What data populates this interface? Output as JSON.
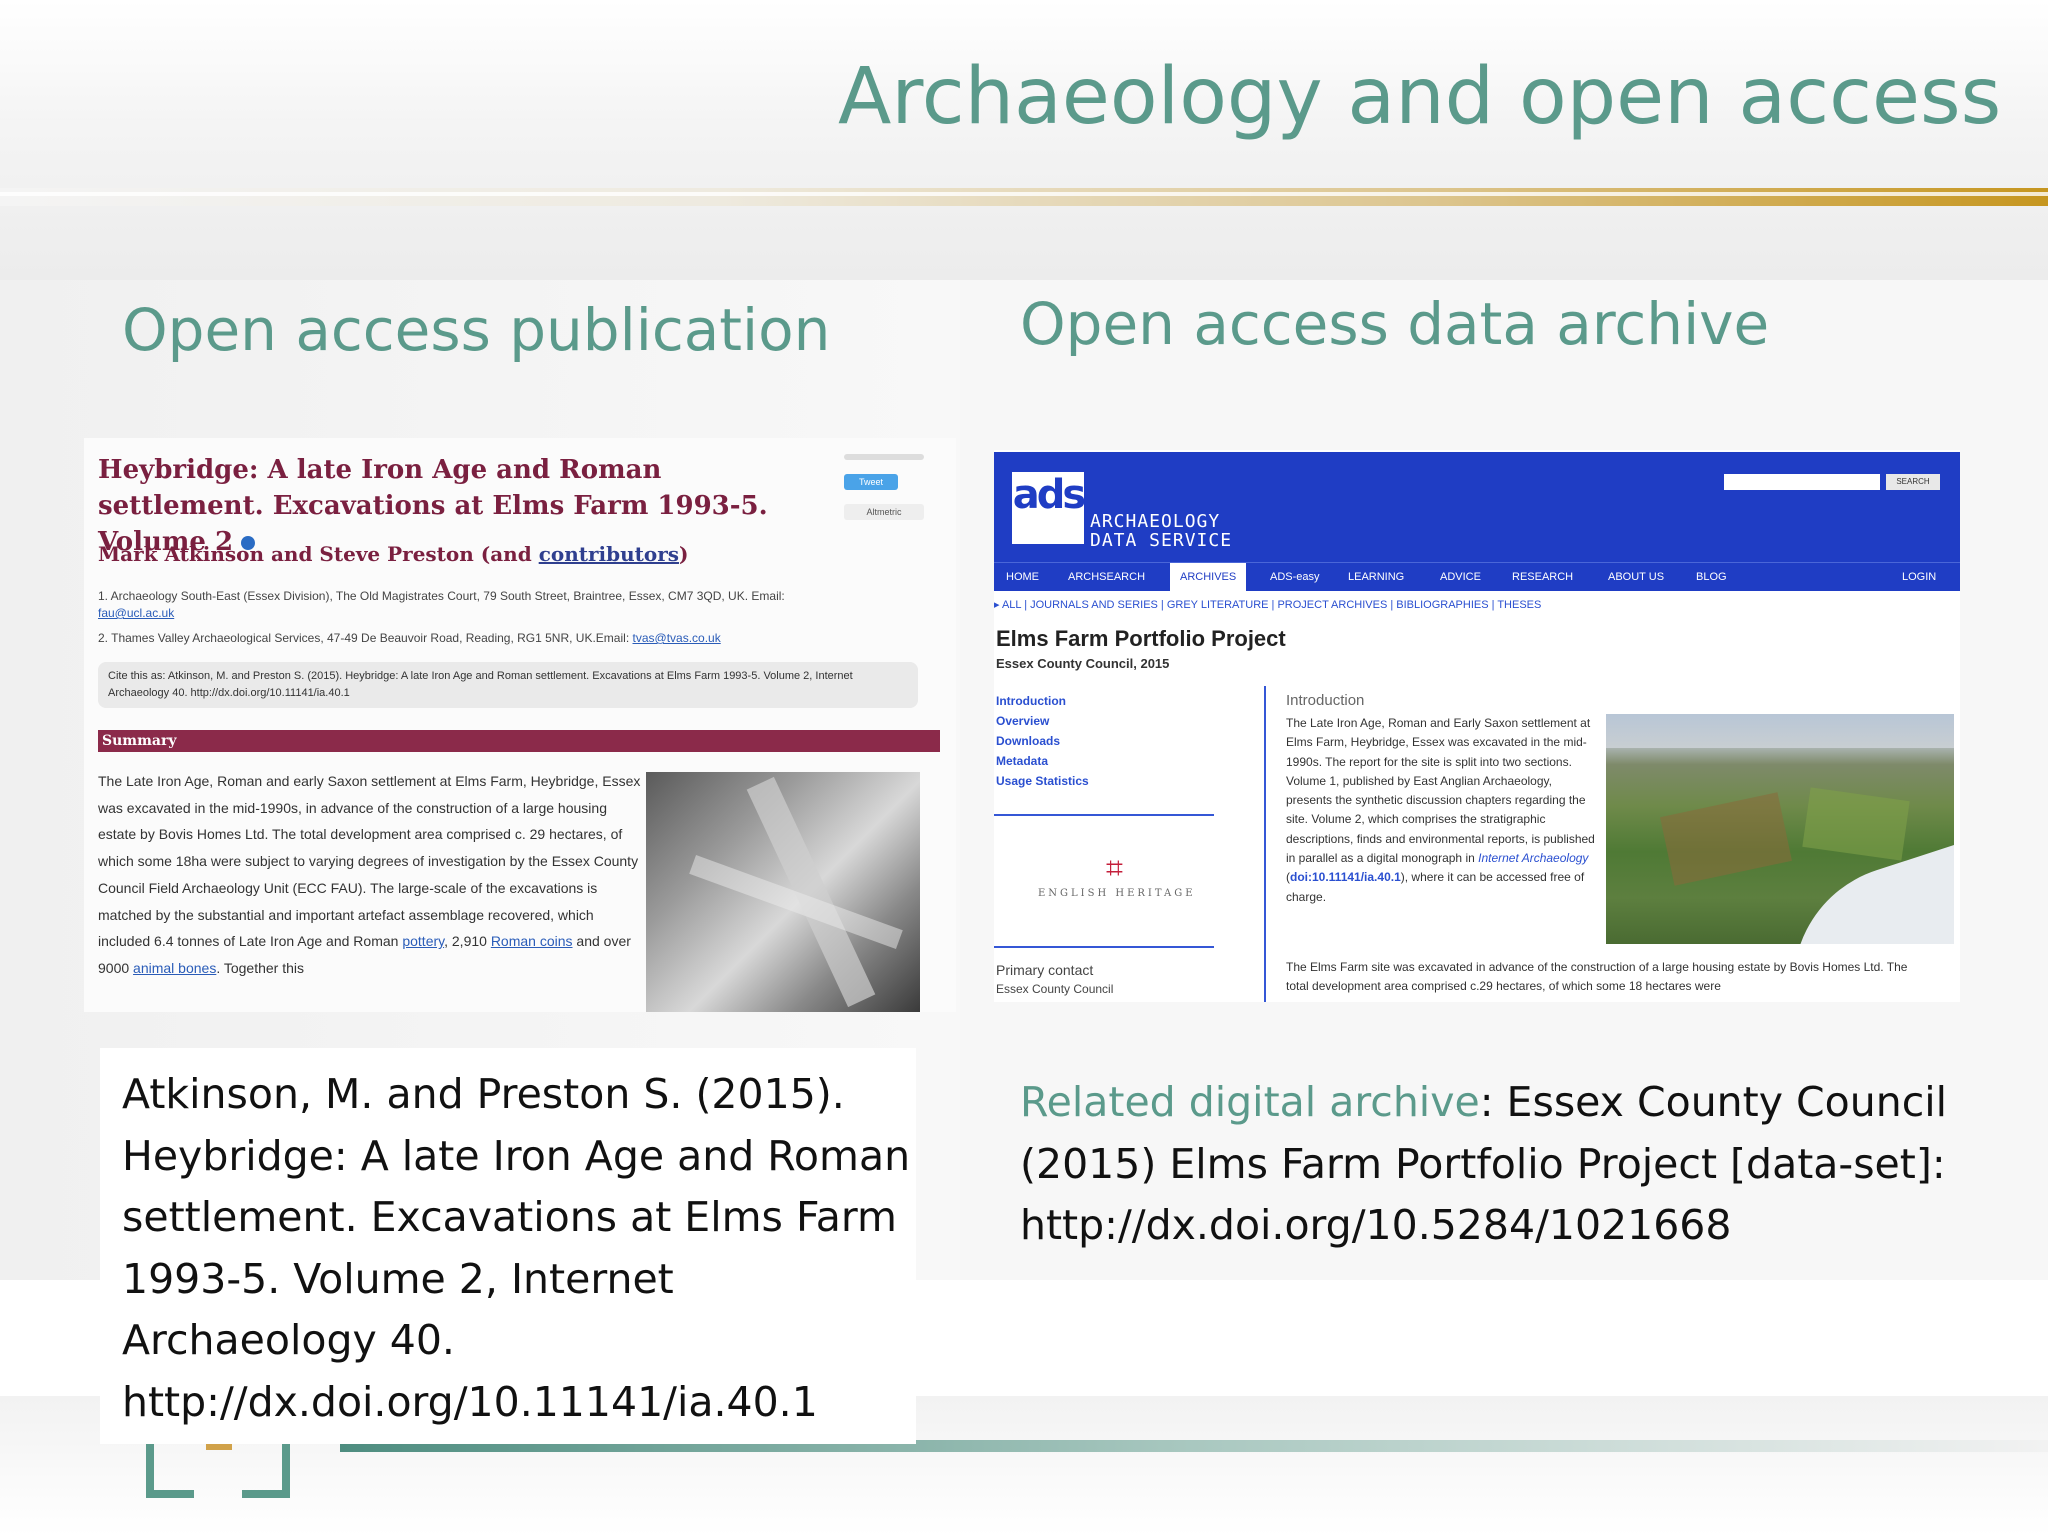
{
  "slide": {
    "title": "Archaeology and open access",
    "left_heading": "Open access publication",
    "right_heading": "Open access data archive",
    "accent_color": "#5b9a8b",
    "gold_color": "#c6961f"
  },
  "publication_screenshot": {
    "title": "Heybridge: A late Iron Age and Roman settlement. Excavations at Elms Farm 1993-5. Volume 2",
    "authors": "Mark Atkinson and Steve Preston (and ",
    "authors_link": "contributors",
    "authors_close": ")",
    "share_buttons": [
      "Tweet",
      "Altmetric"
    ],
    "affiliation_1": "1. Archaeology South-East (Essex Division), The Old Magistrates Court, 79 South Street, Braintree, Essex, CM7 3QD, UK. Email:",
    "affiliation_1_email": "fau@ucl.ac.uk",
    "affiliation_2": "2. Thames Valley Archaeological Services, 47-49 De Beauvoir Road, Reading, RG1 5NR, UK.Email:",
    "affiliation_2_email": "tvas@tvas.co.uk",
    "cite_as": "Cite this as: Atkinson, M. and Preston S. (2015). Heybridge: A late Iron Age and Roman settlement. Excavations at Elms Farm 1993-5. Volume 2, Internet Archaeology 40. http://dx.doi.org/10.11141/ia.40.1",
    "summary_label": "Summary",
    "summary_text": "The Late Iron Age, Roman and early Saxon settlement at Elms Farm, Heybridge, Essex was excavated in the mid-1990s, in advance of the construction of a large housing estate by Bovis Homes Ltd. The total development area comprised c. 29 hectares, of which some 18ha were subject to varying degrees of investigation by the Essex County Council Field Archaeology Unit (ECC FAU). The large-scale of the excavations is matched by the substantial and important artefact assemblage recovered, which included 6.4 tonnes of Late Iron Age and Roman ",
    "summary_link_1": "pottery",
    "summary_mid_1": ", 2,910 ",
    "summary_link_2": "Roman coins",
    "summary_mid_2": " and over 9000 ",
    "summary_link_3": "animal bones",
    "summary_end": ". Together this"
  },
  "ads_screenshot": {
    "logo": "ads",
    "service_name_line1": "ARCHAEOLOGY",
    "service_name_line2": "DATA SERVICE",
    "search_button": "SEARCH",
    "nav": [
      {
        "label": "HOME"
      },
      {
        "label": "ARCHSEARCH"
      },
      {
        "label": "ARCHIVES"
      },
      {
        "label": "ADS-easy"
      },
      {
        "label": "LEARNING"
      },
      {
        "label": "ADVICE"
      },
      {
        "label": "RESEARCH"
      },
      {
        "label": "ABOUT US"
      },
      {
        "label": "BLOG"
      }
    ],
    "active_nav": "ARCHIVES",
    "login": "LOGIN",
    "subnav": "▸ ALL | JOURNALS AND SERIES | GREY LITERATURE | PROJECT ARCHIVES | BIBLIOGRAPHIES | THESES",
    "project_title": "Elms Farm Portfolio Project",
    "project_org": "Essex County Council, 2015",
    "side_links": [
      {
        "label": "Introduction"
      },
      {
        "label": "Overview"
      },
      {
        "label": "Downloads"
      },
      {
        "label": "Metadata"
      },
      {
        "label": "Usage Statistics"
      }
    ],
    "funder": "ENGLISH HERITAGE",
    "primary_contact_label": "Primary contact",
    "primary_contact_value": "Essex County Council",
    "intro_heading": "Introduction",
    "intro_text": "The Late Iron Age, Roman and Early Saxon settlement at Elms Farm, Heybridge, Essex was excavated in the mid-1990s. The report for the site is split into two sections. Volume 1, published by East Anglian Archaeology, presents the synthetic discussion chapters regarding the site. Volume 2, which comprises the stratigraphic descriptions, finds and environmental reports, is published in parallel as a digital monograph in ",
    "intro_journal": "Internet Archaeology",
    "intro_doi": "doi:10.11141/ia.40.1",
    "intro_end": "), where it can be accessed free of charge.",
    "intro_text2": "The Elms Farm site was excavated in advance of the construction of a large housing estate by Bovis Homes Ltd. The total development area comprised c.29 hectares, of which some 18 hectares were"
  },
  "citation": {
    "text": "Atkinson, M. and Preston S. (2015). Heybridge: A late Iron Age and Roman settlement. Excavations at Elms Farm 1993-5. Volume 2, Internet Archaeology 40. http://dx.doi.org/10.11141/ia.40.1"
  },
  "archive_citation": {
    "label": "Related digital archive",
    "text": ": Essex County Council (2015) Elms Farm Portfolio Project [data-set]: http://dx.doi.org/10.5284/1021668"
  }
}
